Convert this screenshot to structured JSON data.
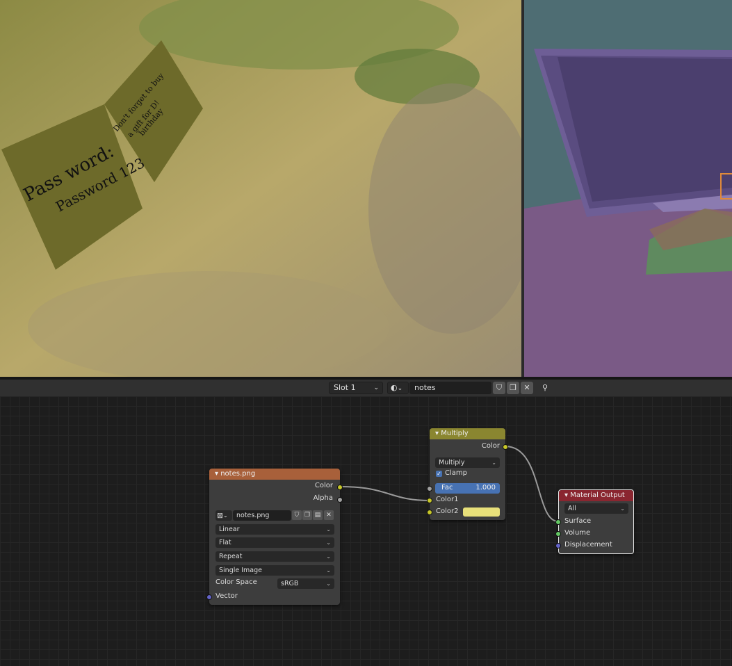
{
  "viewport_left": {
    "note1_line1": "Pass word:",
    "note1_line2": "Password 123",
    "note2_line1": "Don't forget to buy",
    "note2_line2": "a gift for D!",
    "note2_line3": "birthday"
  },
  "header": {
    "slot": "Slot 1",
    "material_name": "notes"
  },
  "image_node": {
    "title": "notes.png",
    "out_color": "Color",
    "out_alpha": "Alpha",
    "image_name": "notes.png",
    "interpolation": "Linear",
    "projection": "Flat",
    "extension": "Repeat",
    "source": "Single Image",
    "color_space_label": "Color Space",
    "color_space": "sRGB",
    "in_vector": "Vector"
  },
  "multiply_node": {
    "title": "Multiply",
    "out_color": "Color",
    "blend_mode": "Multiply",
    "clamp_label": "Clamp",
    "fac_label": "Fac",
    "fac_value": "1.000",
    "in_color1": "Color1",
    "in_color2": "Color2",
    "color2_swatch": "#e8e07a"
  },
  "output_node": {
    "title": "Material Output",
    "target": "All",
    "in_surface": "Surface",
    "in_volume": "Volume",
    "in_displacement": "Displacement"
  },
  "colors": {
    "image_header": "#a8603a",
    "mix_header": "#8a8630",
    "output_header": "#8a2630",
    "color_socket": "#c7c729",
    "shader_socket": "#63c763",
    "vector_socket": "#6363c7",
    "gray_socket": "#a1a1a1",
    "fac_blue": "#4772b3"
  }
}
